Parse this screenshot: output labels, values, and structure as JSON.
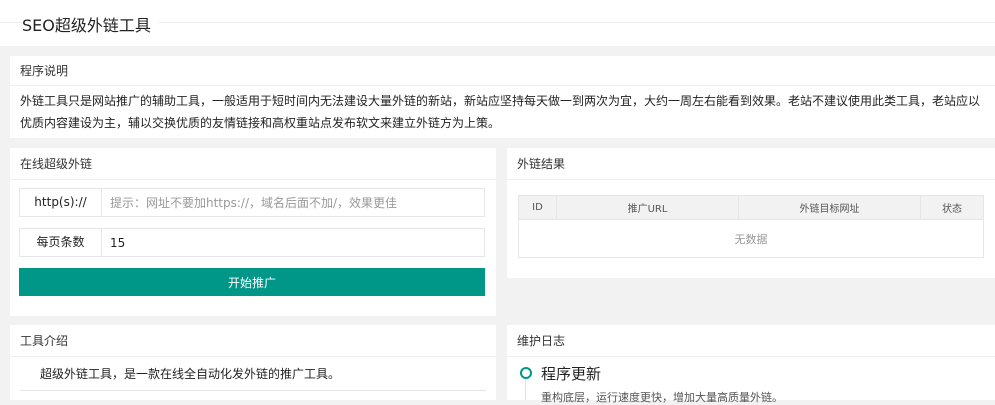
{
  "header": {
    "title": "SEO超级外链工具"
  },
  "description": {
    "title": "程序说明",
    "text": "外链工具只是网站推广的辅助工具，一般适用于短时间内无法建设大量外链的新站，新站应坚持每天做一到两次为宜，大约一周左右能看到效果。老站不建议使用此类工具，老站应以优质内容建设为主，辅以交换优质的友情链接和高权重站点发布软文来建立外链方为上策。"
  },
  "form": {
    "title": "在线超级外链",
    "url_label": "http(s)://",
    "url_placeholder": "提示：网址不要加https://，域名后面不加/，效果更佳",
    "url_value": "",
    "count_label": "每页条数",
    "count_value": "15",
    "submit_label": "开始推广"
  },
  "results": {
    "title": "外链结果",
    "columns": [
      "ID",
      "推广URL",
      "外链目标网址",
      "状态"
    ],
    "empty_text": "无数据"
  },
  "intro": {
    "title": "工具介绍",
    "text": "超级外链工具，是一款在线全自动化发外链的推广工具。"
  },
  "log": {
    "title": "维护日志",
    "entry_title": "程序更新",
    "entry_text": "重构底层，运行速度更快，增加大量高质量外链。"
  },
  "colors": {
    "accent": "#009688",
    "background": "#f2f2f2"
  }
}
